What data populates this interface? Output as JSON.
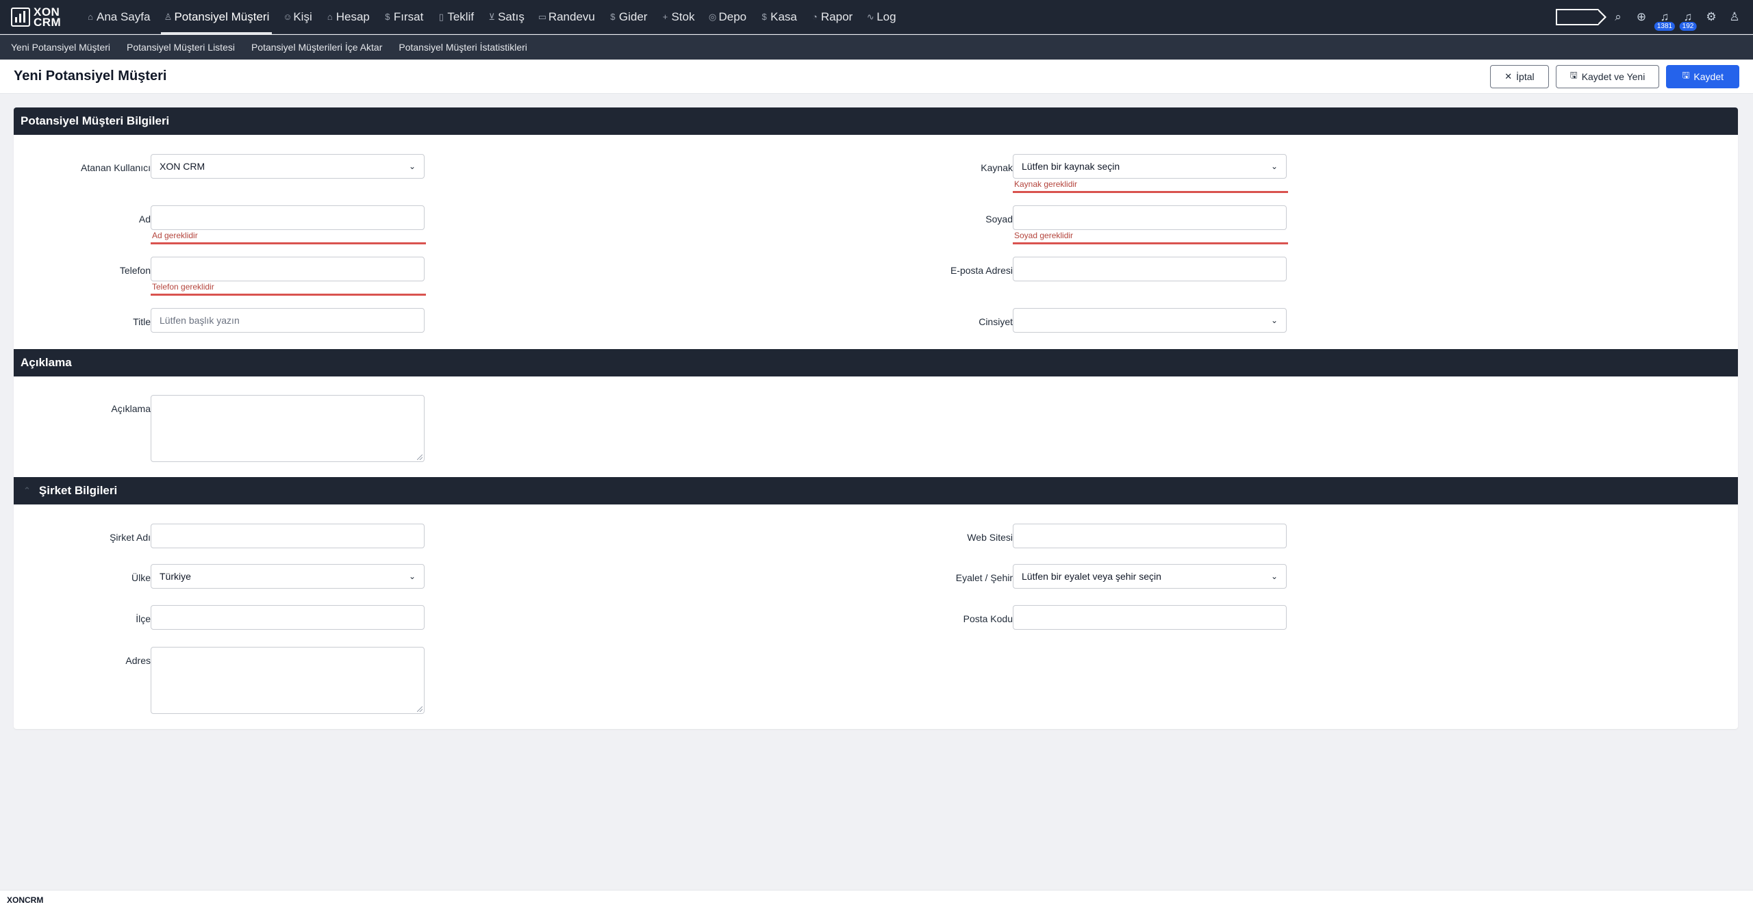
{
  "app": {
    "logo_line1": "XON",
    "logo_line2": "CRM"
  },
  "nav": {
    "items": [
      {
        "label": "Ana Sayfa",
        "icon": "home-icon"
      },
      {
        "label": "Potansiyel Müşteri",
        "icon": "user-icon"
      },
      {
        "label": "Kişi",
        "icon": "users-icon"
      },
      {
        "label": "Hesap",
        "icon": "building-icon"
      },
      {
        "label": "Fırsat",
        "icon": "dollar-icon"
      },
      {
        "label": "Teklif",
        "icon": "document-icon"
      },
      {
        "label": "Satış",
        "icon": "cart-icon"
      },
      {
        "label": "Randevu",
        "icon": "calendar-icon"
      },
      {
        "label": "Gider",
        "icon": "dollar-icon"
      },
      {
        "label": "Stok",
        "icon": "plus-icon"
      },
      {
        "label": "Depo",
        "icon": "warehouse-icon"
      },
      {
        "label": "Kasa",
        "icon": "dollar-icon"
      },
      {
        "label": "Rapor",
        "icon": "chart-pie-icon"
      },
      {
        "label": "Log",
        "icon": "activity-icon"
      }
    ],
    "active_index": 1,
    "notifications_count": "1381",
    "messages_count": "192"
  },
  "subnav": {
    "items": [
      "Yeni Potansiyel Müşteri",
      "Potansiyel Müşteri Listesi",
      "Potansiyel Müşterileri İçe Aktar",
      "Potansiyel Müşteri İstatistikleri"
    ]
  },
  "page": {
    "title": "Yeni Potansiyel Müşteri",
    "cancel_label": "İptal",
    "save_new_label": "Kaydet ve Yeni",
    "save_label": "Kaydet"
  },
  "sections": {
    "lead_info": {
      "title": "Potansiyel Müşteri Bilgileri",
      "assigned_user_label": "Atanan Kullanıcı",
      "assigned_user_value": "XON CRM",
      "source_label": "Kaynak",
      "source_placeholder": "Lütfen bir kaynak seçin",
      "source_error": "Kaynak gereklidir",
      "first_name_label": "Ad",
      "first_name_error": "Ad gereklidir",
      "last_name_label": "Soyad",
      "last_name_error": "Soyad gereklidir",
      "phone_label": "Telefon",
      "phone_error": "Telefon gereklidir",
      "email_label": "E-posta Adresi",
      "title_label": "Title",
      "title_placeholder": "Lütfen başlık yazın",
      "gender_label": "Cinsiyet"
    },
    "description": {
      "title": "Açıklama",
      "description_label": "Açıklama"
    },
    "company": {
      "title": "Şirket Bilgileri",
      "company_name_label": "Şirket Adı",
      "website_label": "Web Sitesi",
      "country_label": "Ülke",
      "country_value": "Türkiye",
      "state_label": "Eyalet / Şehir",
      "state_placeholder": "Lütfen bir eyalet veya şehir seçin",
      "district_label": "İlçe",
      "postal_code_label": "Posta Kodu",
      "address_label": "Adres"
    }
  },
  "footer": {
    "text": "XONCRM"
  },
  "colors": {
    "navbar": "#1f2633",
    "primary": "#2563eb",
    "error": "#d9534f"
  }
}
